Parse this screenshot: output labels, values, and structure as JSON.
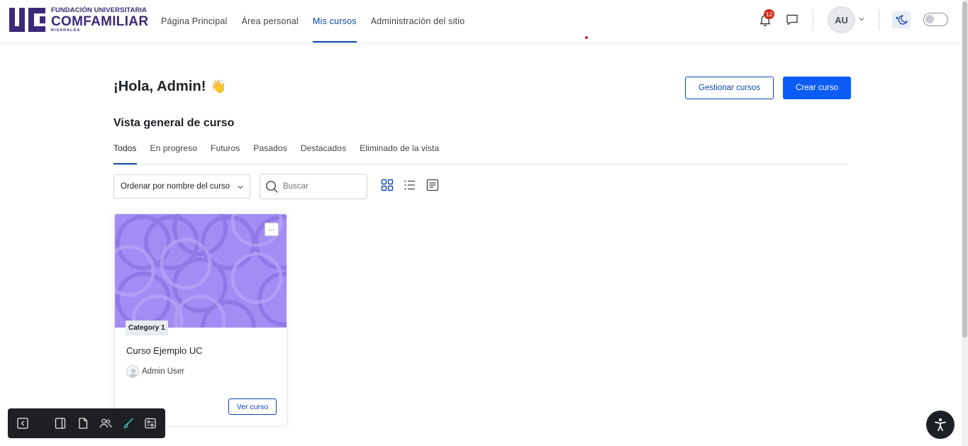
{
  "brand": {
    "line1": "FUNDACIÓN UNIVERSITARIA",
    "line2": "COMFAMILIAR",
    "line3": "RISARALDA",
    "color": "#3c2a78"
  },
  "nav": {
    "links": [
      {
        "label": "Página Principal",
        "active": false
      },
      {
        "label": "Área personal",
        "active": false
      },
      {
        "label": "Mis cursos",
        "active": true
      },
      {
        "label": "Administración del sitio",
        "active": false
      }
    ],
    "notifications_count": "12",
    "user_initials": "AU"
  },
  "main": {
    "greeting": "¡Hola, Admin!",
    "greeting_emoji": "👋",
    "manage_button": "Gestionar cursos",
    "create_button": "Crear curso",
    "section_title": "Vista general de curso",
    "tabs": [
      {
        "label": "Todos",
        "active": true
      },
      {
        "label": "En progreso",
        "active": false
      },
      {
        "label": "Futuros",
        "active": false
      },
      {
        "label": "Pasados",
        "active": false
      },
      {
        "label": "Destacados",
        "active": false
      },
      {
        "label": "Eliminado de la vista",
        "active": false
      }
    ],
    "sort_label": "Ordenar por nombre del curso",
    "search_placeholder": "Buscar"
  },
  "course": {
    "category": "Category 1",
    "title": "Curso Ejemplo UC",
    "teacher": "Admin User",
    "view_button": "Ver curso",
    "menu_glyph": "···",
    "image_color": "#a38df5"
  },
  "colors": {
    "accent": "#0f47ad",
    "primary_button": "#0a5cf5",
    "badge": "#ca3120"
  }
}
